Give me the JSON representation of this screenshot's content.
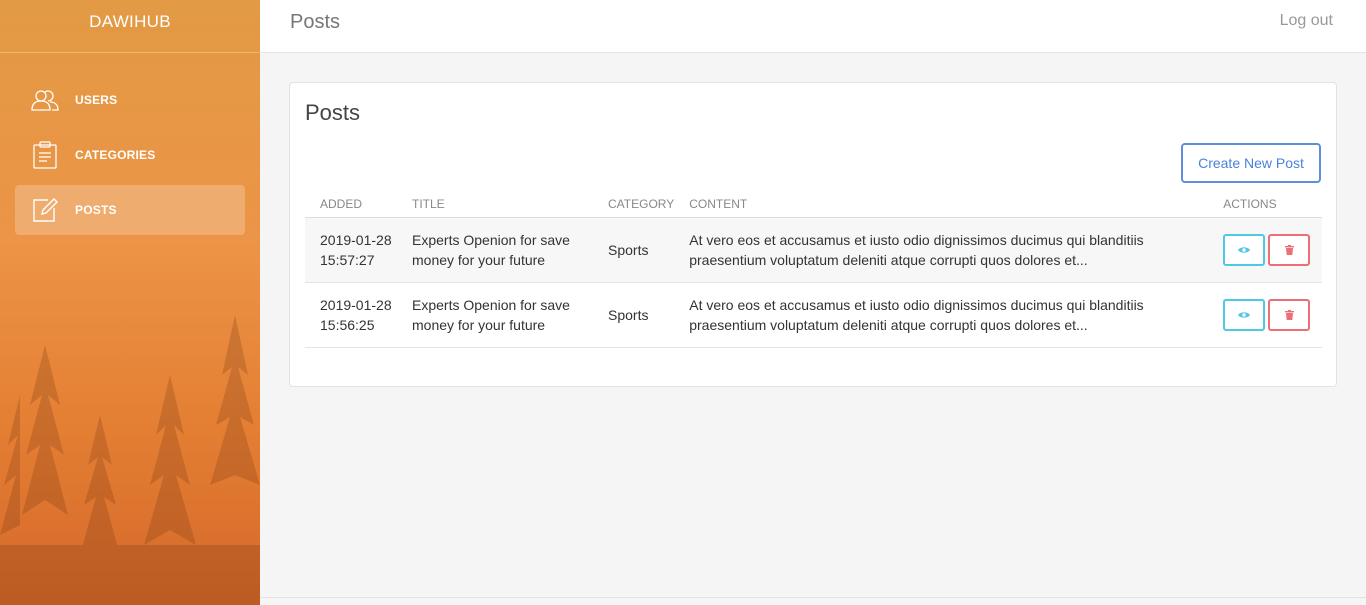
{
  "brand": "DAWIHUB",
  "sidebar": {
    "items": [
      {
        "label": "USERS",
        "icon": "users-icon"
      },
      {
        "label": "CATEGORIES",
        "icon": "clipboard-icon"
      },
      {
        "label": "POSTS",
        "icon": "edit-icon",
        "active": true
      }
    ]
  },
  "header": {
    "title": "Posts",
    "logout": "Log out"
  },
  "card": {
    "title": "Posts",
    "create_label": "Create New Post"
  },
  "table": {
    "headers": [
      "ADDED",
      "TITLE",
      "CATEGORY",
      "CONTENT",
      "ACTIONS"
    ],
    "rows": [
      {
        "added_date": "2019-01-28",
        "added_time": "15:57:27",
        "title_line1": "Experts Openion for save",
        "title_line2": "money for your future",
        "category": "Sports",
        "content_line1": "At vero eos et accusamus et iusto odio dignissimos ducimus qui blanditiis",
        "content_line2": "praesentium voluptatum deleniti atque corrupti quos dolores et..."
      },
      {
        "added_date": "2019-01-28",
        "added_time": "15:56:25",
        "title_line1": "Experts Openion for save",
        "title_line2": "money for your future",
        "category": "Sports",
        "content_line1": "At vero eos et accusamus et iusto odio dignissimos ducimus qui blanditiis",
        "content_line2": "praesentium voluptatum deleniti atque corrupti quos dolores et..."
      }
    ]
  },
  "colors": {
    "sidebar_top": "#e29a44",
    "sidebar_bottom": "#d5682a",
    "primary_outline": "#5f8fdb",
    "info_outline": "#4fc9e2",
    "danger_outline": "#ec6f77"
  }
}
